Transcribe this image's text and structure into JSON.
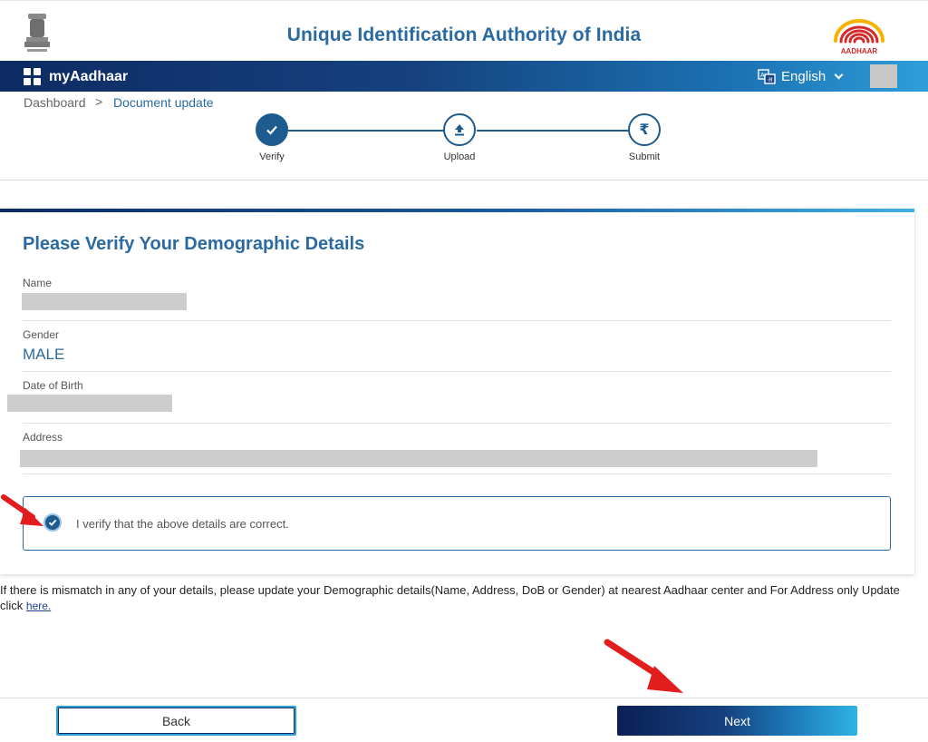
{
  "header": {
    "title": "Unique Identification Authority of India",
    "emblem_icon": "national-emblem-icon",
    "logo_icon": "aadhaar-logo-icon",
    "logo_text": "AADHAAR"
  },
  "nav": {
    "brand": "myAadhaar",
    "language": "English",
    "brand_color": "#15427f"
  },
  "breadcrumb": {
    "home": "Dashboard",
    "separator": ">",
    "current": "Document update"
  },
  "stepper": {
    "steps": [
      {
        "label": "Verify",
        "icon": "check-icon",
        "state": "active"
      },
      {
        "label": "Upload",
        "icon": "upload-icon",
        "state": "pending"
      },
      {
        "label": "Submit",
        "icon": "rupee-icon",
        "state": "pending"
      }
    ]
  },
  "card": {
    "title": "Please Verify Your Demographic Details",
    "fields": [
      {
        "label": "Name",
        "value": ""
      },
      {
        "label": "Gender",
        "value": "MALE"
      },
      {
        "label": "Date of Birth",
        "value": ""
      },
      {
        "label": "Address",
        "value": ""
      }
    ],
    "verify_text": "I verify that the above details are correct.",
    "verify_checked": true
  },
  "note": {
    "text": "If there is mismatch in any of your details, please update your Demographic details(Name, Address, DoB or Gender) at nearest Aadhaar center and For Address only Update click",
    "link": "here."
  },
  "buttons": {
    "back": "Back",
    "next": "Next"
  },
  "colors": {
    "accent": "#2a6aa0",
    "annotation_arrow": "#e11d1d"
  }
}
